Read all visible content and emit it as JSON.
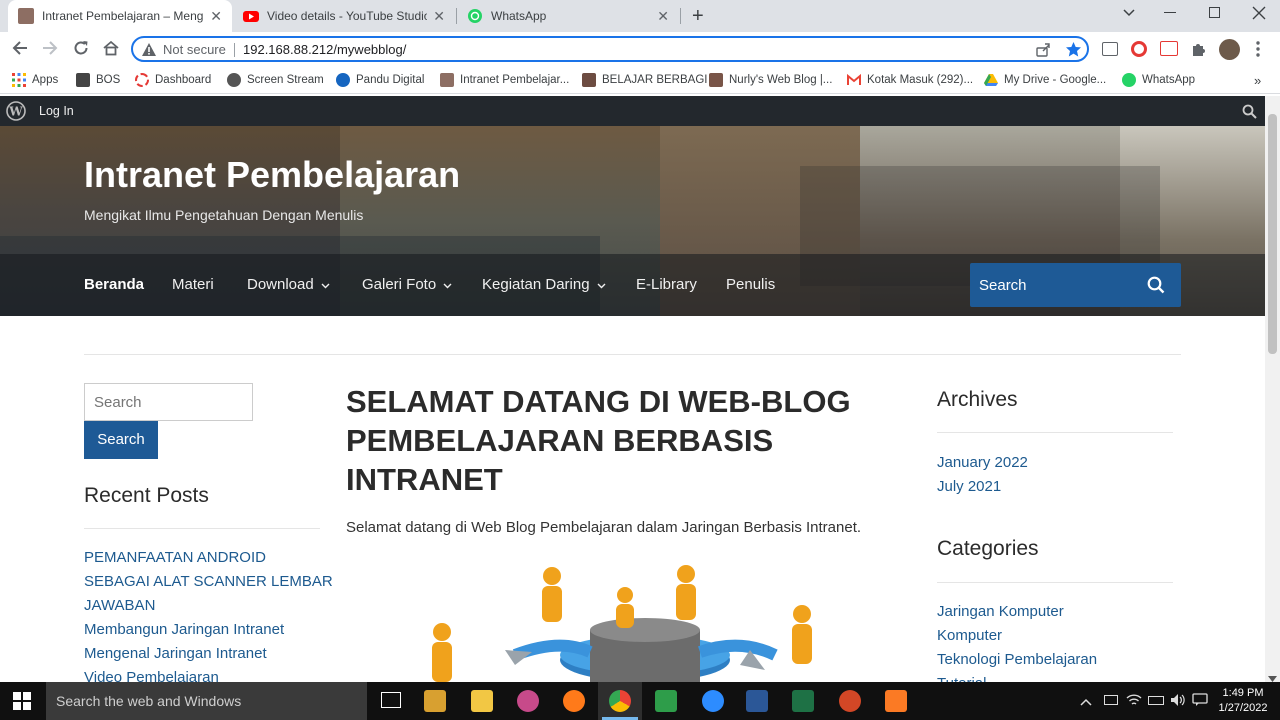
{
  "browser": {
    "tabs": [
      {
        "title": "Intranet Pembelajaran – Mengika",
        "active": true
      },
      {
        "title": "Video details - YouTube Studio",
        "active": false
      },
      {
        "title": "WhatsApp",
        "active": false
      }
    ],
    "new_tab_symbol": "+",
    "close_symbol": "✕",
    "address": {
      "security_label": "Not secure",
      "url": "192.168.88.212/mywebblog/"
    },
    "bookmarks": [
      {
        "label": "Apps",
        "icon": "apps-grid-icon",
        "color": "#ea4335"
      },
      {
        "label": "BOS",
        "icon": "bos-icon",
        "color": "#444444"
      },
      {
        "label": "Dashboard",
        "icon": "dashboard-icon",
        "color": "#e53935"
      },
      {
        "label": "Screen Stream",
        "icon": "screen-stream-icon",
        "color": "#555555"
      },
      {
        "label": "Pandu Digital",
        "icon": "pandu-digital-icon",
        "color": "#1565c0"
      },
      {
        "label": "Intranet Pembelajar...",
        "icon": "intranet-icon",
        "color": "#8d6e63"
      },
      {
        "label": "BELAJAR BERBAGI",
        "icon": "belajar-berbagi-icon",
        "color": "#6d4c41"
      },
      {
        "label": "Nurly's Web Blog |...",
        "icon": "nurly-blog-icon",
        "color": "#795548"
      },
      {
        "label": "Kotak Masuk (292)...",
        "icon": "gmail-icon",
        "color": "#ea4335"
      },
      {
        "label": "My Drive - Google...",
        "icon": "google-drive-icon",
        "color": "#fbbc04"
      },
      {
        "label": "WhatsApp",
        "icon": "whatsapp-icon",
        "color": "#25d366"
      }
    ],
    "bookmarks_more": "»"
  },
  "admin_bar": {
    "login_label": "Log In"
  },
  "site": {
    "title": "Intranet Pembelajaran",
    "tagline": "Mengikat Ilmu Pengetahuan Dengan Menulis",
    "nav": [
      "Beranda",
      "Materi",
      "Download",
      "Galeri Foto",
      "Kegiatan Daring",
      "E-Library",
      "Penulis"
    ],
    "header_search_placeholder": "Search"
  },
  "sidebar_left": {
    "search_placeholder": "Search",
    "search_button": "Search",
    "recent_posts_title": "Recent Posts",
    "recent_posts": [
      "PEMANFAATAN ANDROID",
      "SEBAGAI ALAT SCANNER LEMBAR",
      "JAWABAN",
      "Membangun Jaringan Intranet",
      "Mengenal Jaringan Intranet",
      "Video Pembelajaran"
    ]
  },
  "post": {
    "title": "SELAMAT DATANG DI WEB-BLOG PEMBELAJARAN BERBASIS INTRANET",
    "intro": "Selamat datang di Web Blog Pembelajaran dalam Jaringan Berbasis Intranet."
  },
  "sidebar_right": {
    "archives_title": "Archives",
    "archives": [
      "January 2022",
      "July 2021"
    ],
    "categories_title": "Categories",
    "categories": [
      "Jaringan Komputer",
      "Komputer",
      "Teknologi Pembelajaran",
      "Tutorial"
    ]
  },
  "taskbar": {
    "search_placeholder": "Search the web and Windows",
    "time": "1:49 PM",
    "date": "1/27/2022"
  }
}
